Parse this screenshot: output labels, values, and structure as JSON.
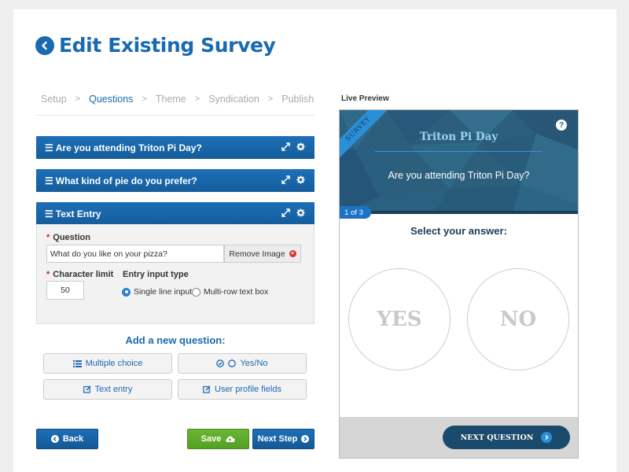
{
  "header": {
    "title": "Edit Existing Survey"
  },
  "steps": [
    {
      "label": "Setup"
    },
    {
      "label": "Questions"
    },
    {
      "label": "Theme"
    },
    {
      "label": "Syndication"
    },
    {
      "label": "Publish"
    }
  ],
  "step_separator": ">",
  "active_step": "Questions",
  "questions": [
    {
      "title": "Are you attending Triton Pi Day?"
    },
    {
      "title": "What kind of pie do you prefer?"
    },
    {
      "title": "Text Entry"
    }
  ],
  "editor": {
    "question_label": "Question",
    "question_value": "What do you like on your pizza?",
    "remove_image_label": "Remove Image",
    "character_limit_label": "Character limit",
    "character_limit_value": "50",
    "entry_type_label": "Entry input type",
    "entry_options": [
      "Single line input",
      "Multi-row text box"
    ],
    "selected_entry_option": "Single line input"
  },
  "add_question": {
    "title": "Add a new question:",
    "buttons": [
      "Multiple choice",
      "Yes/No",
      "Text entry",
      "User profile fields"
    ]
  },
  "actions": {
    "back": "Back",
    "save": "Save",
    "next_step": "Next Step"
  },
  "preview": {
    "label": "Live Preview",
    "ribbon": "SURVEY",
    "survey_title": "Triton Pi Day",
    "help": "?",
    "question": "Are you attending Triton Pi Day?",
    "counter": "1 of 3",
    "prompt": "Select your answer:",
    "answers": [
      "YES",
      "NO"
    ],
    "next_button": "NEXT QUESTION"
  },
  "colors": {
    "primary": "#1a6ab0",
    "success": "#5aa526",
    "preview_header": "#2c5f7c",
    "danger": "#d9312f"
  }
}
